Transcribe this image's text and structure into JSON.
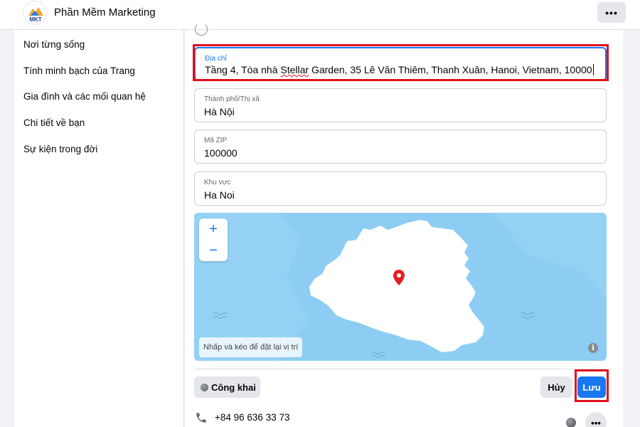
{
  "header": {
    "logo_text": "MKT",
    "title": "Phần Mềm Marketing",
    "more_label": "•••"
  },
  "sidebar": {
    "items": [
      {
        "label": "Nơi từng sống"
      },
      {
        "label": "Tính minh bạch của Trang"
      },
      {
        "label": "Gia đình và các mối quan hệ"
      },
      {
        "label": "Chi tiết về bạn"
      },
      {
        "label": "Sự kiện trong đời"
      }
    ]
  },
  "form": {
    "address": {
      "label": "Địa chỉ",
      "value_before": "Tầng 4, Tòa nhà ",
      "value_spell": "Stellar",
      "value_after": " Garden, 35 Lê Văn Thiêm, Thanh Xuân, Hanoi, Vietnam, 10000"
    },
    "city": {
      "label": "Thành phố/Thị xã",
      "value": "Hà Nội"
    },
    "zip": {
      "label": "Mã ZIP",
      "value": "100000"
    },
    "region": {
      "label": "Khu vực",
      "value": "Ha Noi"
    }
  },
  "map": {
    "zoom_in": "+",
    "zoom_out": "−",
    "hint": "Nhấp và kéo để đặt lại vị trí",
    "info": "i",
    "water_color": "#8ecdf3",
    "land_color": "#ffffff",
    "pin_color": "#e41e26"
  },
  "actions": {
    "privacy_label": "Công khai",
    "cancel_label": "Hủy",
    "save_label": "Lưu"
  },
  "contact": {
    "phone": "+84 96 636 33 73",
    "more_label": "•••"
  },
  "colors": {
    "accent": "#1877f2",
    "highlight": "#e0101b"
  }
}
